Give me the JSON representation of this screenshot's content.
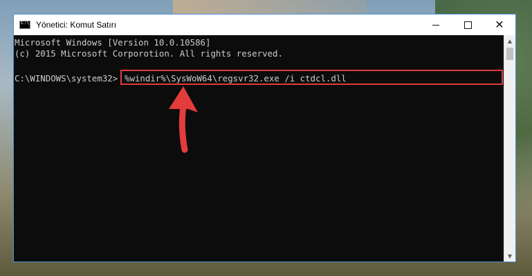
{
  "window": {
    "title": "Yönetici: Komut Satırı",
    "controls": {
      "minimize_icon": "minimize-icon",
      "maximize_icon": "maximize-icon",
      "close_icon": "close-icon",
      "close_glyph": "✕"
    }
  },
  "console": {
    "line1": "Microsoft Windows [Version 10.0.10586]",
    "line2": "(c) 2015 Microsoft Corporotion. All rights reserved.",
    "prompt": "C:\\WINDOWS\\system32>",
    "command": "%windir%\\SysWoW64\\regsvr32.exe /i ctdcl.dll"
  },
  "annotation": {
    "highlight_color": "#e23c3c",
    "arrow_color": "#e23c3c",
    "arrow_icon": "arrow-up-icon"
  },
  "scrollbar": {
    "up_glyph": "▲",
    "down_glyph": "▼"
  }
}
